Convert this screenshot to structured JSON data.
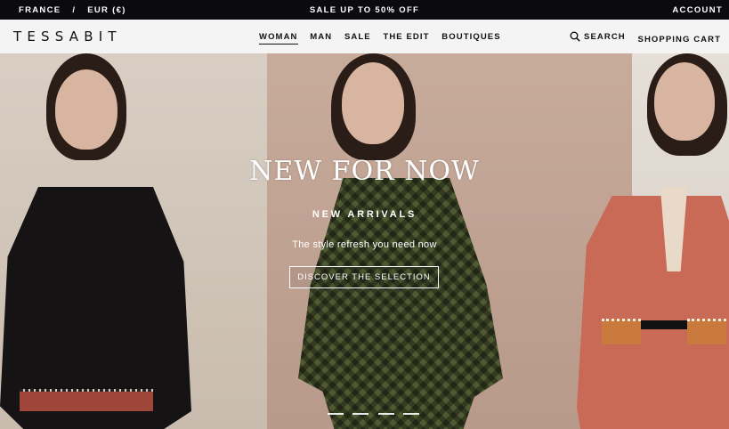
{
  "topbar": {
    "country": "FRANCE",
    "separator": "/",
    "currency": "EUR (€)",
    "promo": "SALE UP TO 50% OFF",
    "account": "ACCOUNT"
  },
  "header": {
    "logo": "TESSABIT",
    "nav": [
      {
        "label": "WOMAN",
        "active": true
      },
      {
        "label": "MAN",
        "active": false
      },
      {
        "label": "SALE",
        "active": false
      },
      {
        "label": "THE EDIT",
        "active": false
      },
      {
        "label": "BOUTIQUES",
        "active": false
      }
    ],
    "search_label": "SEARCH",
    "cart_label": "SHOPPING CART",
    "icons": {
      "search": "search-icon"
    }
  },
  "hero": {
    "title": "NEW FOR NOW",
    "subtitle": "NEW ARRIVALS",
    "tagline": "The style refresh you need now",
    "cta_label": "DISCOVER THE SELECTION",
    "slides_count": 4,
    "active_slide": 1
  },
  "colors": {
    "topbar_bg": "#0b0b0f",
    "header_bg": "#f4f4f4",
    "text_dark": "#111111",
    "text_light": "#ffffff"
  }
}
